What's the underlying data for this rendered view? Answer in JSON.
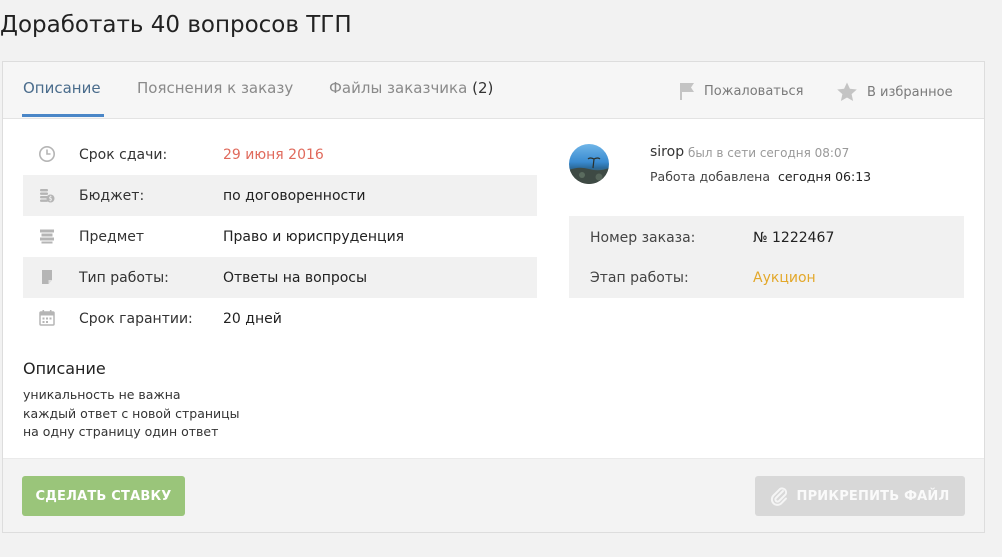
{
  "page": {
    "title": "Доработать 40 вопросов ТГП"
  },
  "tabs": [
    {
      "label": "Описание"
    },
    {
      "label": "Пояснения к заказу"
    },
    {
      "label": "Файлы заказчика",
      "count": "(2)"
    }
  ],
  "tools": {
    "report": "Пожаловаться",
    "favorite": "В избранное"
  },
  "details": [
    {
      "label": "Срок сдачи:",
      "value": "29 июня 2016",
      "icon": "clock-icon"
    },
    {
      "label": "Бюджет:",
      "value": "по договоренности",
      "icon": "coins-icon"
    },
    {
      "label": "Предмет",
      "value": "Право и юриспруденция",
      "icon": "books-icon"
    },
    {
      "label": "Тип работы:",
      "value": "Ответы на вопросы",
      "icon": "document-icon"
    },
    {
      "label": "Срок гарантии:",
      "value": "20 дней",
      "icon": "calendar-icon"
    }
  ],
  "description": {
    "title": "Описание",
    "lines": [
      "уникальность не важна",
      "каждый ответ с новой страницы",
      "на одну страницу один ответ"
    ]
  },
  "user": {
    "name": "sirop",
    "status": "был в сети сегодня 08:07",
    "added_label": "Работа добавлена",
    "added_value": "сегодня 06:13"
  },
  "order": {
    "number_label": "Номер заказа:",
    "number_value": "№ 1222467",
    "stage_label": "Этап работы:",
    "stage_value": "Аукцион"
  },
  "buttons": {
    "bid": "СДЕЛАТЬ СТАВКУ",
    "attach": "ПРИКРЕПИТЬ ФАЙЛ"
  },
  "colors": {
    "deadline": "#e06a5c",
    "stage": "#e3a82b",
    "bid_button": "#9ac57a",
    "tab_active": "#4a86c7"
  }
}
